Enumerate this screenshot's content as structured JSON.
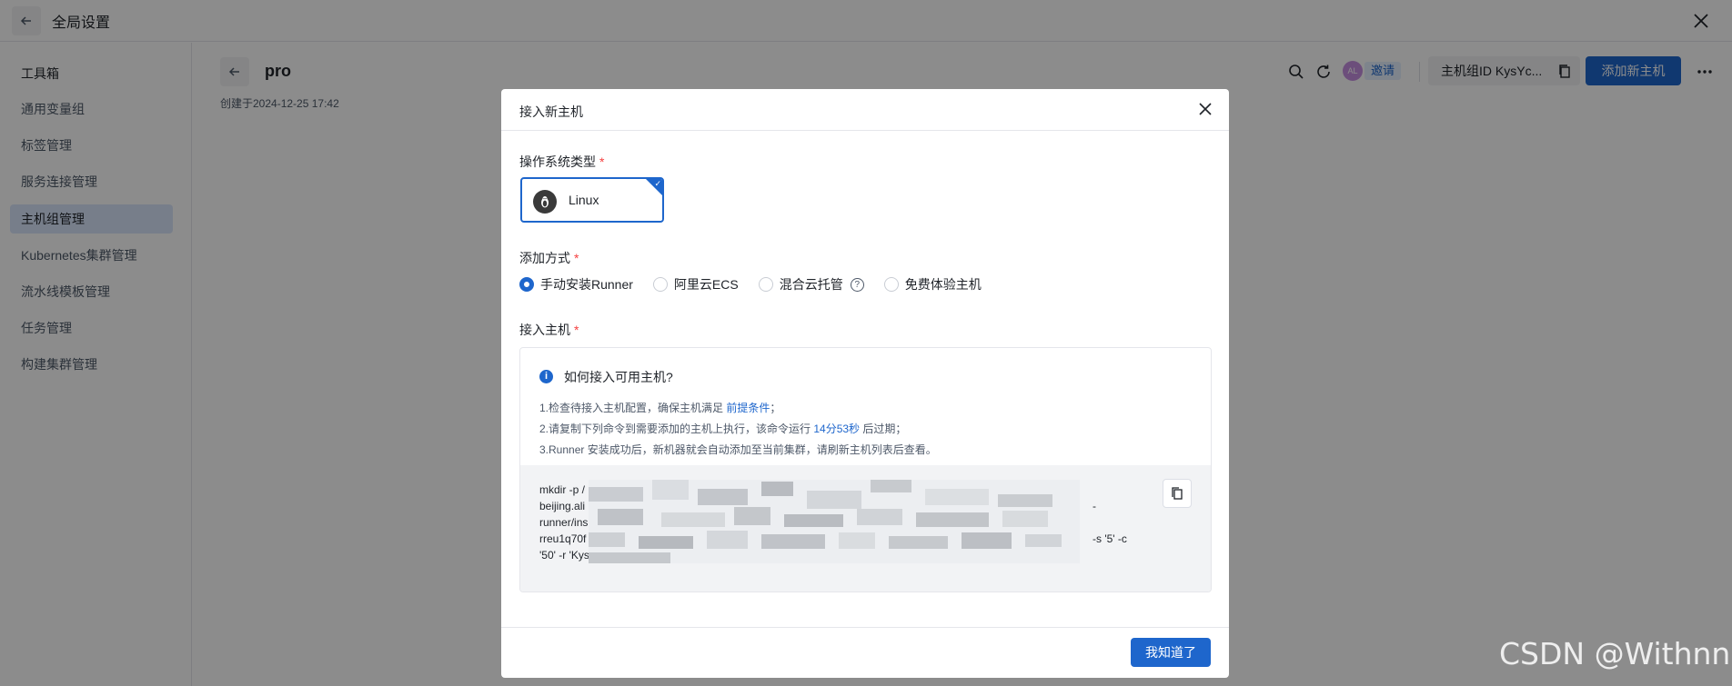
{
  "topbar": {
    "title": "全局设置"
  },
  "sidebar": {
    "heading": "工具箱",
    "items": [
      {
        "label": "通用变量组"
      },
      {
        "label": "标签管理"
      },
      {
        "label": "服务连接管理"
      },
      {
        "label": "主机组管理",
        "active": true
      },
      {
        "label": "Kubernetes集群管理"
      },
      {
        "label": "流水线模板管理"
      },
      {
        "label": "任务管理"
      },
      {
        "label": "构建集群管理"
      }
    ]
  },
  "main": {
    "title": "pro",
    "created": "创建于2024-12-25 17:42",
    "avatar_text": "AL",
    "invite_label": "邀请",
    "host_group_id": "主机组ID KysYc...",
    "add_host_label": "添加新主机"
  },
  "modal": {
    "title": "接入新主机",
    "os_label": "操作系统类型",
    "os_selected": "Linux",
    "method_label": "添加方式",
    "methods": [
      {
        "label": "手动安装Runner",
        "checked": true
      },
      {
        "label": "阿里云ECS",
        "checked": false
      },
      {
        "label": "混合云托管",
        "checked": false
      },
      {
        "label": "免费体验主机",
        "checked": false
      }
    ],
    "host_label": "接入主机",
    "help": {
      "title": "如何接入可用主机?",
      "step1_prefix": "1.检查待接入主机配置，确保主机满足 ",
      "step1_link": "前提条件",
      "step1_suffix": "；",
      "step2_prefix": "2.请复制下列命令到需要添加的主机上执行，该命令运行 ",
      "step2_time": "14分53秒",
      "step2_suffix": " 后过期；",
      "step3": "3.Runner 安装成功后，新机器就会自动添加至当前集群，请刷新主机列表后查看。"
    },
    "command_lines": [
      "mkdir -p /",
      "beijing.ali",
      "runner/ins",
      "rreu1q70f",
      "'50' -r 'Kys"
    ],
    "command_tails": [
      "",
      "-",
      "",
      "-s '5' -c",
      ""
    ],
    "ok_label": "我知道了"
  },
  "watermark": "CSDN @Withnn",
  "colors": {
    "accent": "#1e66cc",
    "required": "#f53f3f",
    "overlay": "rgba(0,0,0,0.45)"
  }
}
